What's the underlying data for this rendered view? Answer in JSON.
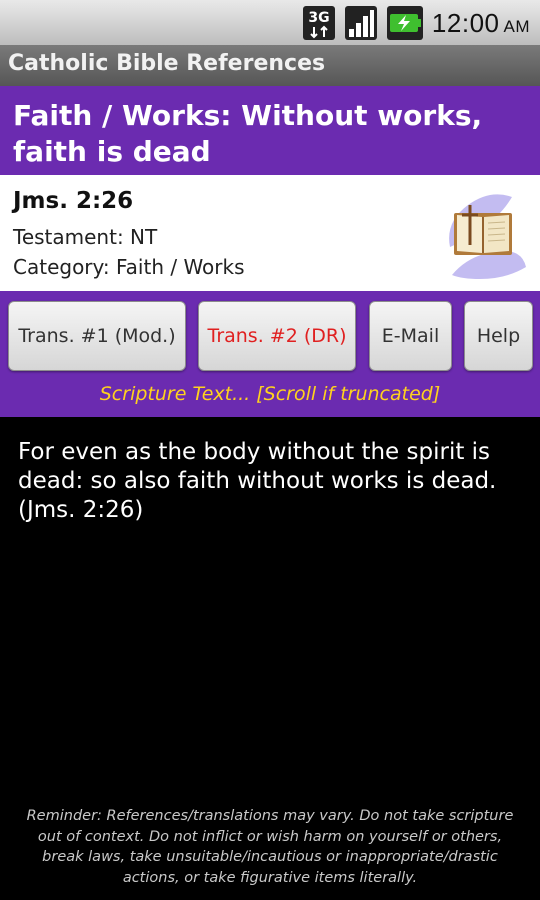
{
  "status_bar": {
    "network_label": "3G",
    "time": "12:00",
    "ampm": "AM",
    "icons": [
      "network-3g-icon",
      "signal-strength-icon",
      "battery-charging-icon"
    ]
  },
  "app": {
    "title": "Catholic Bible References"
  },
  "entry": {
    "heading": "Faith / Works: Without works, faith is dead",
    "reference": "Jms. 2:26",
    "testament": "Testament: NT",
    "category": "Category: Faith / Works",
    "icon": "open-bible-icon"
  },
  "buttons": {
    "trans1": "Trans. #1 (Mod.)",
    "trans2": "Trans. #2 (DR)",
    "email": "E-Mail",
    "help": "Help"
  },
  "hint": "Scripture Text... [Scroll if truncated]",
  "scripture_text": "For even as the body without the spirit is dead: so also faith without works is dead. (Jms. 2:26)",
  "reminder": "Reminder: References/translations may vary. Do not take scripture out of context. Do not inflict or wish harm on yourself or others, break laws, take unsuitable/incautious or inappropriate/drastic actions, or take figurative items literally.",
  "colors": {
    "accent_purple": "#6b2bb0",
    "hint_yellow": "#ffd21e",
    "active_button_text": "#e02020"
  }
}
